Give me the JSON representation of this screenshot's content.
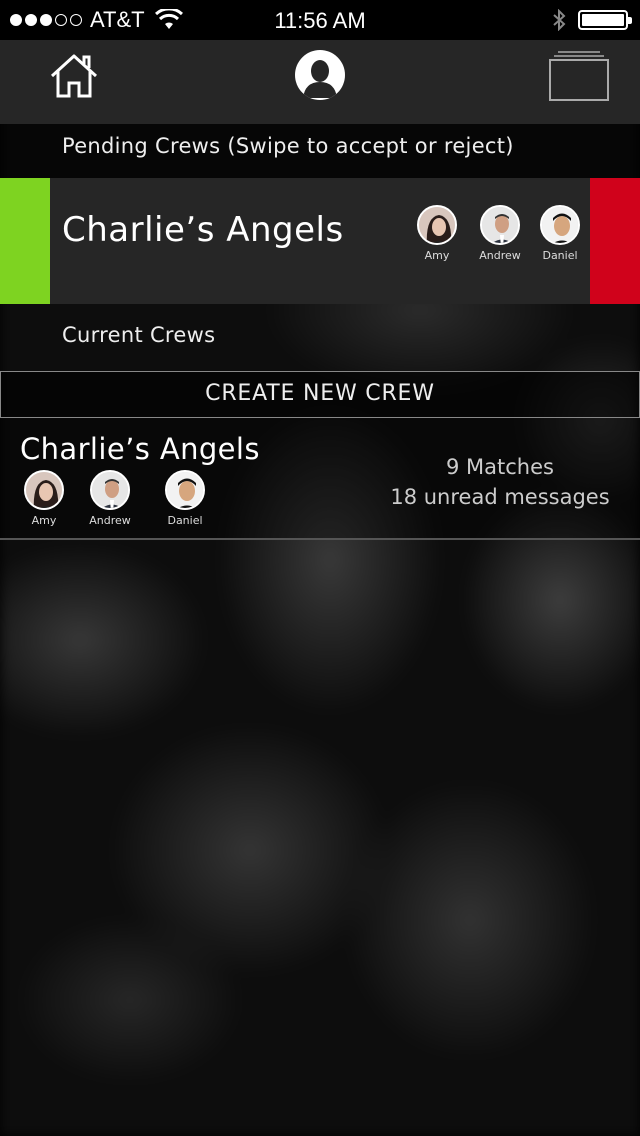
{
  "status_bar": {
    "carrier": "AT&T",
    "time": "11:56 AM",
    "signal_strength": 3,
    "signal_max": 5
  },
  "nav": {
    "home_icon": "home-icon",
    "profile_icon": "profile-icon",
    "cards_icon": "cards-icon"
  },
  "pending": {
    "label": "Pending Crews (Swipe to accept or reject)",
    "crew": {
      "title": "Charlie’s Angels",
      "members": [
        "Amy",
        "Andrew",
        "Daniel"
      ]
    },
    "accept_color": "#7ed321",
    "reject_color": "#d0021b"
  },
  "current": {
    "label": "Current Crews",
    "create_button": "CREATE NEW CREW",
    "crews": [
      {
        "title": "Charlie’s Angels",
        "members": [
          "Amy",
          "Andrew",
          "Daniel"
        ],
        "matches": "9 Matches",
        "unread": "18 unread messages"
      }
    ]
  }
}
